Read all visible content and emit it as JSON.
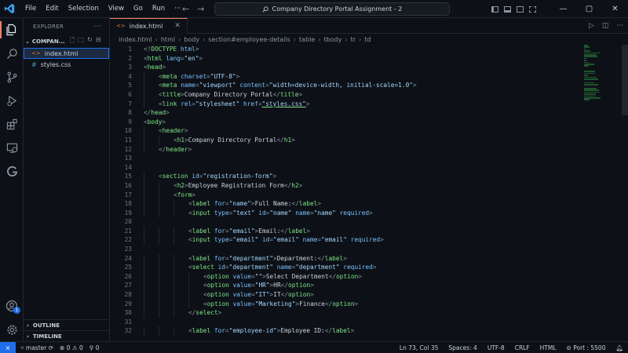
{
  "menu": [
    "File",
    "Edit",
    "Selection",
    "View",
    "Go",
    "Run"
  ],
  "window": {
    "title": "Company Directory Portal Assignment - 2",
    "minimize": "—",
    "maximize": "▢",
    "close": "✕"
  },
  "explorer": {
    "header": "EXPLORER",
    "folder": "COMPAN...",
    "files": [
      {
        "name": "index.html",
        "icon": "<>"
      },
      {
        "name": "styles.css",
        "icon": "#"
      }
    ],
    "outline": "OUTLINE",
    "timeline": "TIMELINE"
  },
  "tab": {
    "icon": "<>",
    "name": "index.html"
  },
  "breadcrumb": [
    "index.html",
    "html",
    "body",
    "section#employee-details",
    "table",
    "tbody",
    "tr",
    "td"
  ],
  "code_lines": [
    {
      "n": "1",
      "indent": 0,
      "html": "<span class=\"pun\">&lt;!</span><span class=\"tag\">DOCTYPE</span> <span class=\"att\">html</span><span class=\"pun\">&gt;</span>"
    },
    {
      "n": "2",
      "indent": 0,
      "html": "<span class=\"pun\">&lt;</span><span class=\"tag\">html</span> <span class=\"att\">lang</span><span class=\"pun\">=</span><span class=\"val\">\"en\"</span><span class=\"pun\">&gt;</span>"
    },
    {
      "n": "3",
      "indent": 0,
      "html": "<span class=\"pun\">&lt;</span><span class=\"tag\">head</span><span class=\"pun\">&gt;</span>"
    },
    {
      "n": "4",
      "indent": 1,
      "html": "<span class=\"pun\">&lt;</span><span class=\"tag\">meta</span> <span class=\"att\">charset</span><span class=\"pun\">=</span><span class=\"val\">\"UTF-8\"</span><span class=\"pun\">&gt;</span>"
    },
    {
      "n": "5",
      "indent": 1,
      "html": "<span class=\"pun\">&lt;</span><span class=\"tag\">meta</span> <span class=\"att\">name</span><span class=\"pun\">=</span><span class=\"val\">\"viewport\"</span> <span class=\"att\">content</span><span class=\"pun\">=</span><span class=\"val\">\"width=device-width, initial-scale=1.0\"</span><span class=\"pun\">&gt;</span>"
    },
    {
      "n": "6",
      "indent": 1,
      "html": "<span class=\"pun\">&lt;</span><span class=\"tag\">title</span><span class=\"pun\">&gt;</span><span class=\"txt\">Company Directory Portal</span><span class=\"pun\">&lt;/</span><span class=\"tag\">title</span><span class=\"pun\">&gt;</span>"
    },
    {
      "n": "7",
      "indent": 1,
      "html": "<span class=\"pun\">&lt;</span><span class=\"tag\">link</span> <span class=\"att\">rel</span><span class=\"pun\">=</span><span class=\"val\">\"stylesheet\"</span> <span class=\"att\">href</span><span class=\"pun\">=</span><span class=\"val und\">\"styles.css\"</span><span class=\"pun\">&gt;</span>"
    },
    {
      "n": "8",
      "indent": 0,
      "html": "<span class=\"pun\">&lt;/</span><span class=\"tag\">head</span><span class=\"pun\">&gt;</span>"
    },
    {
      "n": "9",
      "indent": 0,
      "html": "<span class=\"pun\">&lt;</span><span class=\"tag\">body</span><span class=\"pun\">&gt;</span>"
    },
    {
      "n": "10",
      "indent": 1,
      "html": "<span class=\"pun\">&lt;</span><span class=\"tag\">header</span><span class=\"pun\">&gt;</span>"
    },
    {
      "n": "11",
      "indent": 2,
      "html": "<span class=\"pun\">&lt;</span><span class=\"tag\">h1</span><span class=\"pun\">&gt;</span><span class=\"txt\">Company Directory Portal</span><span class=\"pun\">&lt;/</span><span class=\"tag\">h1</span><span class=\"pun\">&gt;</span>"
    },
    {
      "n": "12",
      "indent": 1,
      "html": "<span class=\"pun\">&lt;/</span><span class=\"tag\">header</span><span class=\"pun\">&gt;</span>"
    },
    {
      "n": "13",
      "indent": 0,
      "html": ""
    },
    {
      "n": "14",
      "indent": 0,
      "html": ""
    },
    {
      "n": "15",
      "indent": 1,
      "html": "<span class=\"pun\">&lt;</span><span class=\"tag\">section</span> <span class=\"att\">id</span><span class=\"pun\">=</span><span class=\"val\">\"registration-form\"</span><span class=\"pun\">&gt;</span>"
    },
    {
      "n": "16",
      "indent": 2,
      "html": "<span class=\"pun\">&lt;</span><span class=\"tag\">h2</span><span class=\"pun\">&gt;</span><span class=\"txt\">Employee Registration Form</span><span class=\"pun\">&lt;/</span><span class=\"tag\">h2</span><span class=\"pun\">&gt;</span>"
    },
    {
      "n": "17",
      "indent": 2,
      "html": "<span class=\"pun\">&lt;</span><span class=\"tag\">form</span><span class=\"pun\">&gt;</span>"
    },
    {
      "n": "18",
      "indent": 3,
      "html": "<span class=\"pun\">&lt;</span><span class=\"tag\">label</span> <span class=\"att\">for</span><span class=\"pun\">=</span><span class=\"val\">\"name\"</span><span class=\"pun\">&gt;</span><span class=\"txt\">Full Name:</span><span class=\"pun\">&lt;/</span><span class=\"tag\">label</span><span class=\"pun\">&gt;</span>"
    },
    {
      "n": "19",
      "indent": 3,
      "html": "<span class=\"pun\">&lt;</span><span class=\"tag\">input</span> <span class=\"att\">type</span><span class=\"pun\">=</span><span class=\"val\">\"text\"</span> <span class=\"att\">id</span><span class=\"pun\">=</span><span class=\"val\">\"name\"</span> <span class=\"att\">name</span><span class=\"pun\">=</span><span class=\"val\">\"name\"</span> <span class=\"att\">required</span><span class=\"pun\">&gt;</span>"
    },
    {
      "n": "20",
      "indent": 0,
      "html": ""
    },
    {
      "n": "21",
      "indent": 3,
      "html": "<span class=\"pun\">&lt;</span><span class=\"tag\">label</span> <span class=\"att\">for</span><span class=\"pun\">=</span><span class=\"val\">\"email\"</span><span class=\"pun\">&gt;</span><span class=\"txt\">Email:</span><span class=\"pun\">&lt;/</span><span class=\"tag\">label</span><span class=\"pun\">&gt;</span>"
    },
    {
      "n": "22",
      "indent": 3,
      "html": "<span class=\"pun\">&lt;</span><span class=\"tag\">input</span> <span class=\"att\">type</span><span class=\"pun\">=</span><span class=\"val\">\"email\"</span> <span class=\"att\">id</span><span class=\"pun\">=</span><span class=\"val\">\"email\"</span> <span class=\"att\">name</span><span class=\"pun\">=</span><span class=\"val\">\"email\"</span> <span class=\"att\">required</span><span class=\"pun\">&gt;</span>"
    },
    {
      "n": "23",
      "indent": 0,
      "html": ""
    },
    {
      "n": "24",
      "indent": 3,
      "html": "<span class=\"pun\">&lt;</span><span class=\"tag\">label</span> <span class=\"att\">for</span><span class=\"pun\">=</span><span class=\"val\">\"department\"</span><span class=\"pun\">&gt;</span><span class=\"txt\">Department:</span><span class=\"pun\">&lt;/</span><span class=\"tag\">label</span><span class=\"pun\">&gt;</span>"
    },
    {
      "n": "25",
      "indent": 3,
      "html": "<span class=\"pun\">&lt;</span><span class=\"tag\">select</span> <span class=\"att\">id</span><span class=\"pun\">=</span><span class=\"val\">\"department\"</span> <span class=\"att\">name</span><span class=\"pun\">=</span><span class=\"val\">\"department\"</span> <span class=\"att\">required</span><span class=\"pun\">&gt;</span>"
    },
    {
      "n": "26",
      "indent": 4,
      "html": "<span class=\"pun\">&lt;</span><span class=\"tag\">option</span> <span class=\"att\">value</span><span class=\"pun\">=</span><span class=\"val\">\"\"</span><span class=\"pun\">&gt;</span><span class=\"txt\">Select Department</span><span class=\"pun\">&lt;/</span><span class=\"tag\">option</span><span class=\"pun\">&gt;</span>"
    },
    {
      "n": "27",
      "indent": 4,
      "html": "<span class=\"pun\">&lt;</span><span class=\"tag\">option</span> <span class=\"att\">value</span><span class=\"pun\">=</span><span class=\"val\">\"HR\"</span><span class=\"pun\">&gt;</span><span class=\"txt\">HR</span><span class=\"pun\">&lt;/</span><span class=\"tag\">option</span><span class=\"pun\">&gt;</span>"
    },
    {
      "n": "28",
      "indent": 4,
      "html": "<span class=\"pun\">&lt;</span><span class=\"tag\">option</span> <span class=\"att\">value</span><span class=\"pun\">=</span><span class=\"val\">\"IT\"</span><span class=\"pun\">&gt;</span><span class=\"txt\">IT</span><span class=\"pun\">&lt;/</span><span class=\"tag\">option</span><span class=\"pun\">&gt;</span>"
    },
    {
      "n": "29",
      "indent": 4,
      "html": "<span class=\"pun\">&lt;</span><span class=\"tag\">option</span> <span class=\"att\">value</span><span class=\"pun\">=</span><span class=\"val\">\"Marketing\"</span><span class=\"pun\">&gt;</span><span class=\"txt\">Finance</span><span class=\"pun\">&lt;/</span><span class=\"tag\">option</span><span class=\"pun\">&gt;</span>"
    },
    {
      "n": "30",
      "indent": 3,
      "html": "<span class=\"pun\">&lt;/</span><span class=\"tag\">select</span><span class=\"pun\">&gt;</span>"
    },
    {
      "n": "31",
      "indent": 0,
      "html": ""
    },
    {
      "n": "32",
      "indent": 3,
      "html": "<span class=\"pun\">&lt;</span><span class=\"tag\">label</span> <span class=\"att\">for</span><span class=\"pun\">=</span><span class=\"val\">\"employee-id\"</span><span class=\"pun\">&gt;</span><span class=\"txt\">Employee ID:</span><span class=\"pun\">&lt;/</span><span class=\"tag\">label</span><span class=\"pun\">&gt;</span>"
    }
  ],
  "status": {
    "remote": "⨯",
    "branch": "master",
    "errors": "0",
    "warnings": "0",
    "ports_count": "0",
    "position": "Ln 73, Col 35",
    "spaces": "Spaces: 4",
    "encoding": "UTF-8",
    "eol": "CRLF",
    "language": "HTML",
    "port": "Port : 5500"
  },
  "accounts_badge": "1",
  "colors": {
    "accent": "#1f6feb",
    "tab_indicator": "#f78166",
    "tag": "#7ee787",
    "attribute": "#79c0ff",
    "value": "#a5d6ff"
  }
}
